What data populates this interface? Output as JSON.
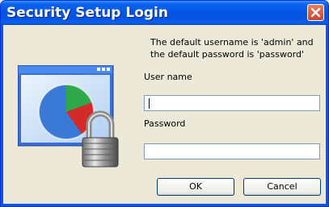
{
  "window": {
    "title": "Security Setup Login"
  },
  "info": {
    "line1": "The default username is 'admin' and",
    "line2": "the default password is 'password'"
  },
  "form": {
    "username_label": "User name",
    "username_value": "",
    "password_label": "Password",
    "password_value": ""
  },
  "buttons": {
    "ok": "OK",
    "cancel": "Cancel"
  },
  "icons": {
    "close": "close-icon",
    "security": "security-lock-icon"
  }
}
